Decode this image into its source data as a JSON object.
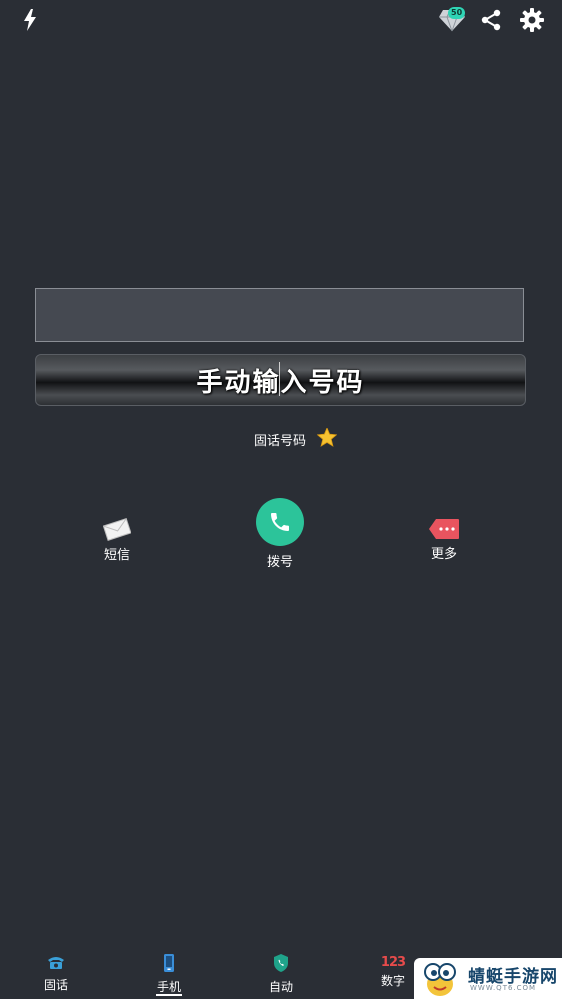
{
  "topbar": {
    "flash_icon": "flash-icon",
    "diamond_badge": "50",
    "share_icon": "share-icon",
    "settings_icon": "gear-icon"
  },
  "number_display": {
    "value": ""
  },
  "manual_input": {
    "label": "手动输入号码"
  },
  "landline": {
    "label": "固话号码",
    "icon": "star-icon"
  },
  "actions": [
    {
      "label": "短信",
      "icon": "envelope-icon"
    },
    {
      "label": "拨号",
      "icon": "phone-icon"
    },
    {
      "label": "更多",
      "icon": "more-tag-icon"
    }
  ],
  "bottom_nav": [
    {
      "label": "固话",
      "icon": "landline-phone-icon"
    },
    {
      "label": "手机",
      "icon": "mobile-phone-icon",
      "active": true
    },
    {
      "label": "自动",
      "icon": "shield-phone-icon"
    },
    {
      "label": "数字",
      "icon": "numbers-icon",
      "icon_text": "123"
    }
  ],
  "watermark": {
    "text": "蜻蜓手游网",
    "sub": "WWW.QT6.COM"
  },
  "colors": {
    "background": "#2a2e35",
    "accent": "#2cc49a",
    "diamond": "#2fd5b5",
    "more": "#e9545f"
  }
}
